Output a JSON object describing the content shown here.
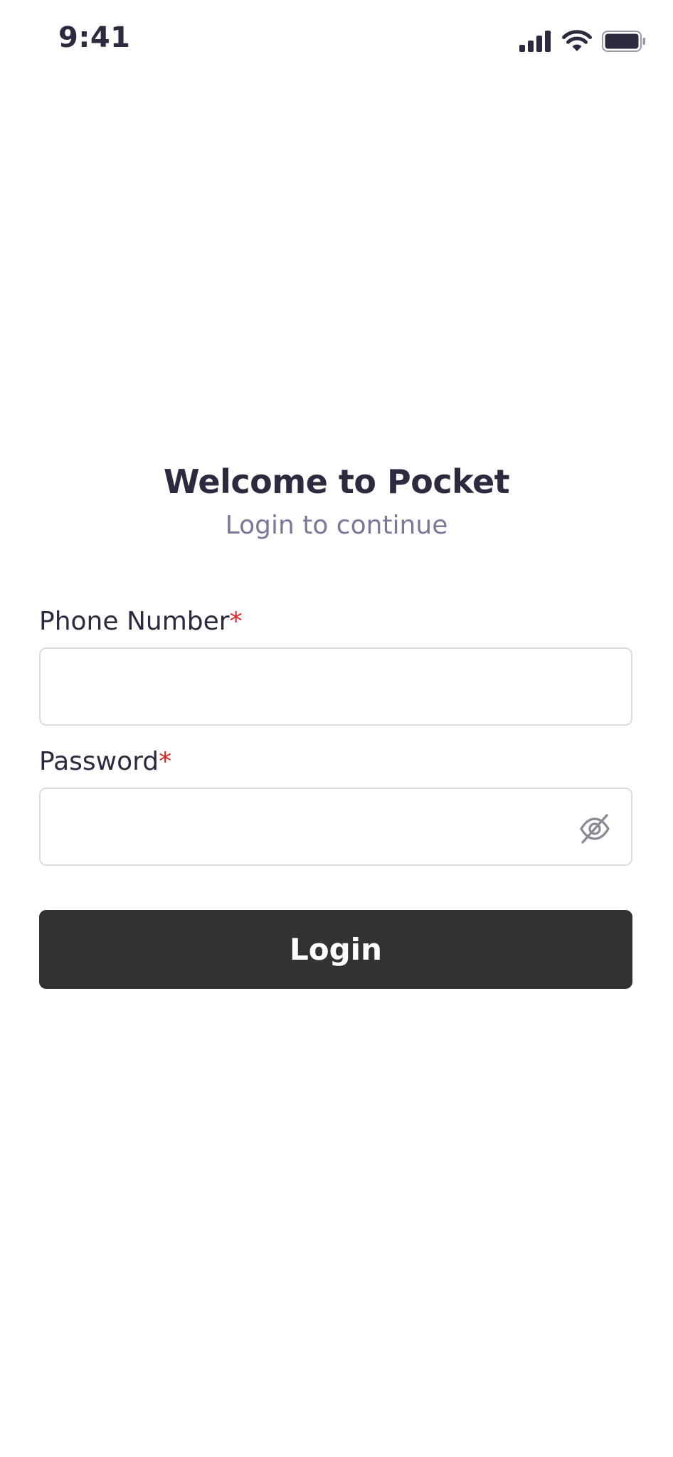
{
  "status_bar": {
    "time": "9:41",
    "icons": [
      "cellular-signal-icon",
      "wifi-icon",
      "battery-icon"
    ]
  },
  "header": {
    "title": "Welcome to Pocket",
    "subtitle": "Login to continue"
  },
  "form": {
    "phone": {
      "label": "Phone Number",
      "required_mark": "*",
      "value": "",
      "placeholder": ""
    },
    "password": {
      "label": "Password",
      "required_mark": "*",
      "value": "",
      "placeholder": "",
      "toggle_icon": "eye-off-icon"
    },
    "submit_label": "Login"
  },
  "colors": {
    "text_primary": "#2b2a3f",
    "text_secondary": "#7a7898",
    "required": "#e02424",
    "button_bg": "#323232",
    "button_text": "#ffffff",
    "input_border": "#dcdce0"
  }
}
